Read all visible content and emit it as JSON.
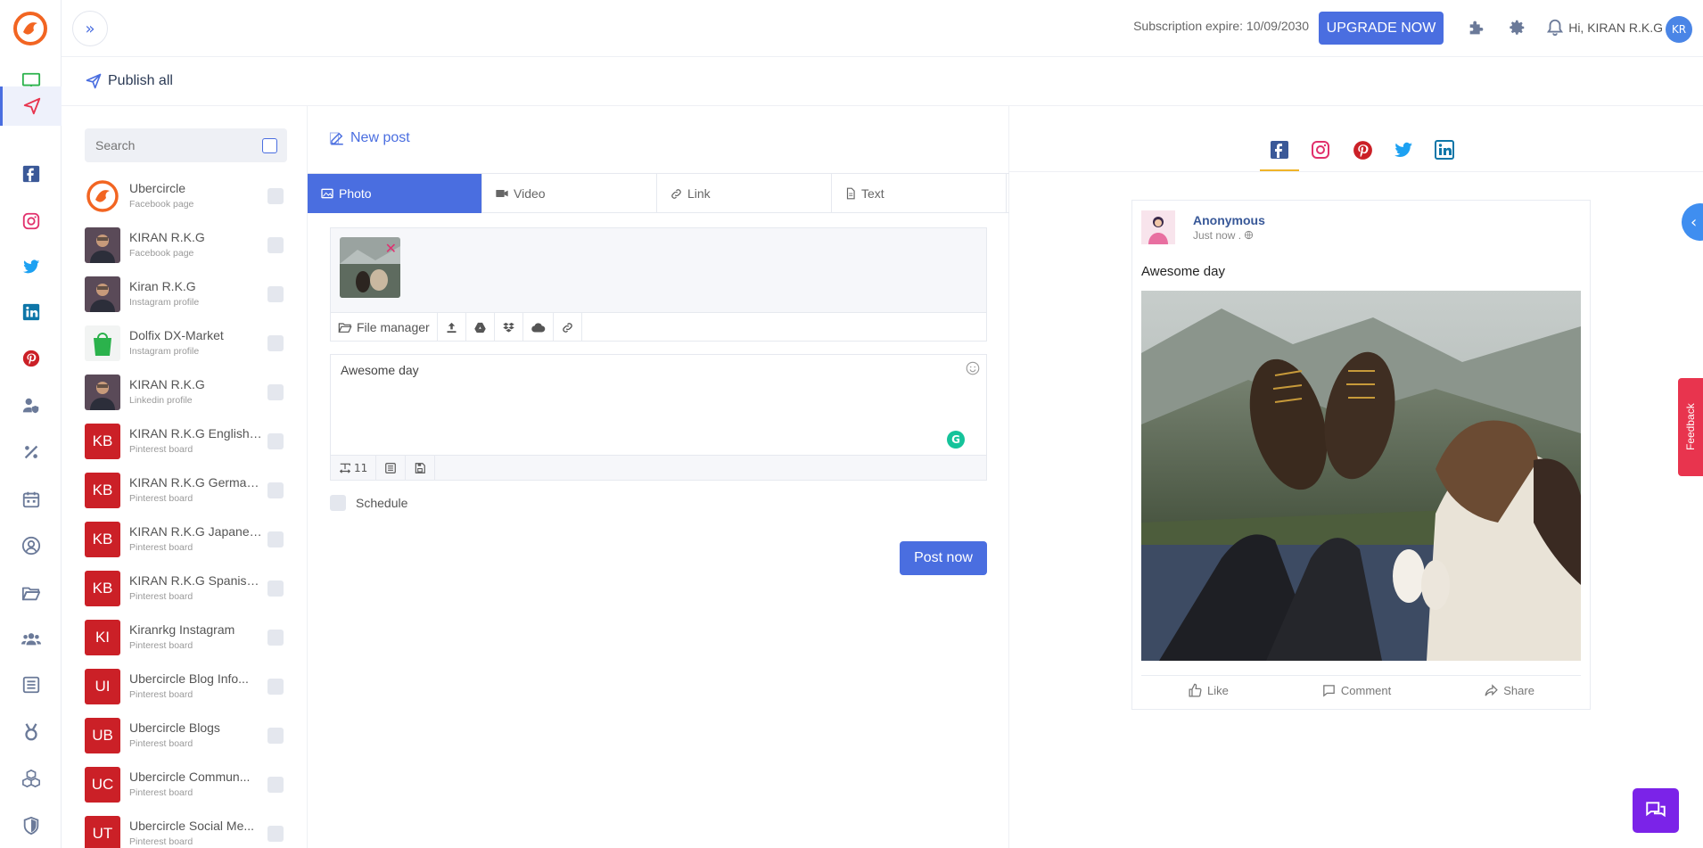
{
  "header": {
    "subscription_text": "Subscription expire: 10/09/2030",
    "upgrade_label": "UPGRADE NOW",
    "greeting": "Hi, KIRAN R.K.G",
    "avatar_initials": "KR"
  },
  "page": {
    "title": "Publish all"
  },
  "accounts": {
    "search_placeholder": "Search",
    "items": [
      {
        "name": "Ubercircle",
        "type": "Facebook page",
        "avatar": "logo"
      },
      {
        "name": "KIRAN R.K.G",
        "type": "Facebook page",
        "avatar": "photo"
      },
      {
        "name": "Kiran R.K.G",
        "type": "Instagram profile",
        "avatar": "photo"
      },
      {
        "name": "Dolfix DX-Market",
        "type": "Instagram profile",
        "avatar": "bag"
      },
      {
        "name": "KIRAN R.K.G",
        "type": "Linkedin profile",
        "avatar": "photo"
      },
      {
        "name": "KIRAN R.K.G English Bl...",
        "type": "Pinterest board",
        "initials": "KB"
      },
      {
        "name": "KIRAN R.K.G German ...",
        "type": "Pinterest board",
        "initials": "KB"
      },
      {
        "name": "KIRAN R.K.G Japanes...",
        "type": "Pinterest board",
        "initials": "KB"
      },
      {
        "name": "KIRAN R.K.G Spanish ...",
        "type": "Pinterest board",
        "initials": "KB"
      },
      {
        "name": "Kiranrkg Instagram",
        "type": "Pinterest board",
        "initials": "KI"
      },
      {
        "name": "Ubercircle Blog Info...",
        "type": "Pinterest board",
        "initials": "UI"
      },
      {
        "name": "Ubercircle Blogs",
        "type": "Pinterest board",
        "initials": "UB"
      },
      {
        "name": "Ubercircle Commun...",
        "type": "Pinterest board",
        "initials": "UC"
      },
      {
        "name": "Ubercircle Social Me...",
        "type": "Pinterest board",
        "initials": "UT"
      }
    ]
  },
  "composer": {
    "title": "New post",
    "tabs": [
      "Photo",
      "Video",
      "Link",
      "Text"
    ],
    "active_tab": "Photo",
    "file_manager_label": "File manager",
    "caption": "Awesome day",
    "char_count": "11",
    "schedule_label": "Schedule",
    "post_button": "Post now"
  },
  "preview": {
    "networks": [
      "facebook",
      "instagram",
      "pinterest",
      "twitter",
      "linkedin"
    ],
    "active_network": "facebook",
    "author": "Anonymous",
    "time": "Just now .",
    "text": "Awesome day",
    "actions": [
      "Like",
      "Comment",
      "Share"
    ]
  },
  "feedback_label": "Feedback",
  "colors": {
    "primary": "#4a6ee0",
    "pinterest_red": "#cb2027",
    "facebook": "#3b5998",
    "instagram": "#e1306c",
    "twitter": "#1da1f2",
    "linkedin": "#0e76a8",
    "chat": "#7b23e8"
  }
}
